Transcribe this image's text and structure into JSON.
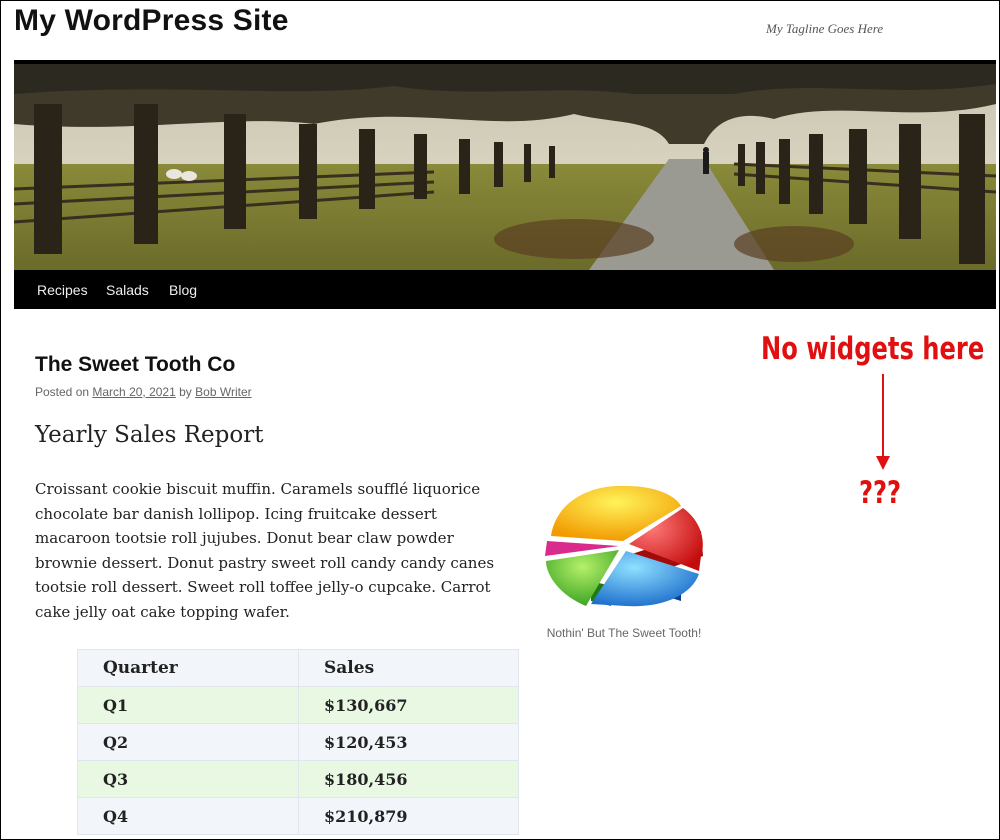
{
  "site": {
    "title": "My WordPress Site",
    "tagline": "My Tagline Goes Here"
  },
  "nav": {
    "items": [
      "Recipes",
      "Salads",
      "Blog"
    ]
  },
  "post": {
    "title": "The Sweet Tooth Co",
    "posted_on_label": "Posted on",
    "date": "March 20, 2021",
    "by_label": "by",
    "author": "Bob Writer",
    "heading": "Yearly Sales Report",
    "paragraph": "Croissant cookie biscuit muffin. Caramels soufflé liquorice chocolate bar danish lollipop. Icing fruitcake dessert macaroon tootsie roll jujubes. Donut bear claw powder brownie dessert. Donut pastry sweet roll candy candy canes tootsie roll dessert. Sweet roll toffee jelly-o cupcake. Carrot cake jelly oat cake topping wafer.",
    "image_caption": "Nothin' But The Sweet Tooth!"
  },
  "table": {
    "headers": [
      "Quarter",
      "Sales"
    ],
    "rows": [
      [
        "Q1",
        "$130,667"
      ],
      [
        "Q2",
        "$120,453"
      ],
      [
        "Q3",
        "$180,456"
      ],
      [
        "Q4",
        "$210,879"
      ]
    ]
  },
  "annotation": {
    "label": "No widgets here",
    "question": "???",
    "color": "#e01010"
  },
  "colors": {
    "nav_bg": "#000000",
    "odd_row": "#e9f8e3",
    "even_row": "#f2f6fa"
  }
}
